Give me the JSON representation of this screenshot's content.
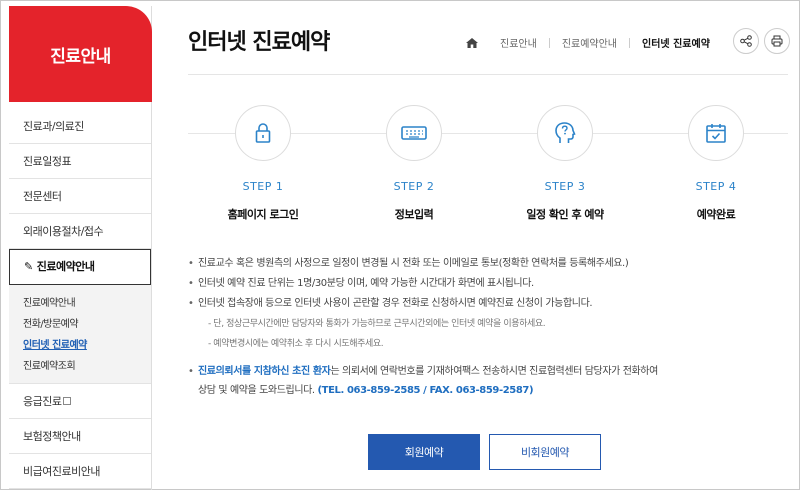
{
  "sidebar": {
    "title": "진료안내",
    "items": [
      {
        "label": "진료과/의료진"
      },
      {
        "label": "진료일정표"
      },
      {
        "label": "전문센터"
      },
      {
        "label": "외래이용절차/접수"
      },
      {
        "label": "진료예약안내"
      }
    ],
    "sub_items": [
      {
        "label": "진료예약안내"
      },
      {
        "label": "전화/방문예약"
      },
      {
        "label": "인터넷 진료예약"
      },
      {
        "label": "진료예약조회"
      }
    ],
    "items_after": [
      {
        "label": "응급진료"
      },
      {
        "label": "보험정책안내"
      },
      {
        "label": "비급여진료비안내"
      }
    ]
  },
  "header": {
    "title": "인터넷 진료예약",
    "breadcrumb": [
      "진료안내",
      "진료예약안내",
      "인터넷 진료예약"
    ]
  },
  "steps": [
    {
      "num": "STEP 1",
      "label": "홈페이지 로그인",
      "icon": "lock-icon"
    },
    {
      "num": "STEP 2",
      "label": "정보입력",
      "icon": "keyboard-icon"
    },
    {
      "num": "STEP 3",
      "label": "일정 확인 후 예약",
      "icon": "head-question-icon"
    },
    {
      "num": "STEP 4",
      "label": "예약완료",
      "icon": "calendar-check-icon"
    }
  ],
  "notes": [
    "진료교수 혹은 병원측의 사정으로 일정이 변경될 시 전화 또는 이메일로 통보(정확한 연락처를 등록해주세요.)",
    "인터넷 예약 진료 단위는 1명/30분당 이며, 예약 가능한 시간대가 화면에 표시됩니다.",
    "인터넷 접속장애 등으로 인터넷 사용이 곤란할 경우 전화로 신청하시면 예약진료 신청이 가능합니다."
  ],
  "subnotes": [
    "- 단, 정상근무시간에만 담당자와 통화가 가능하므로 근무시간외에는 인터넷 예약을 이용하세요.",
    "- 예약변경시에는 예약취소 후 다시 시도해주세요."
  ],
  "referral": {
    "highlight": "진료의뢰서를 지참하신 초진 환자",
    "text1": "는 의뢰서에 연락번호를 기재하여팩스 전송하시면 진료협력센터 담당자가 전화하여",
    "text2": "상담 및 예약을 도와드립니다. ",
    "contact": "(TEL. 063-859-2585 / FAX. 063-859-2587)"
  },
  "buttons": {
    "member": "회원예약",
    "guest": "비회원예약"
  },
  "colors": {
    "brand_red": "#e4232b",
    "step_blue": "#2c83c9",
    "button_blue": "#2459b0"
  }
}
